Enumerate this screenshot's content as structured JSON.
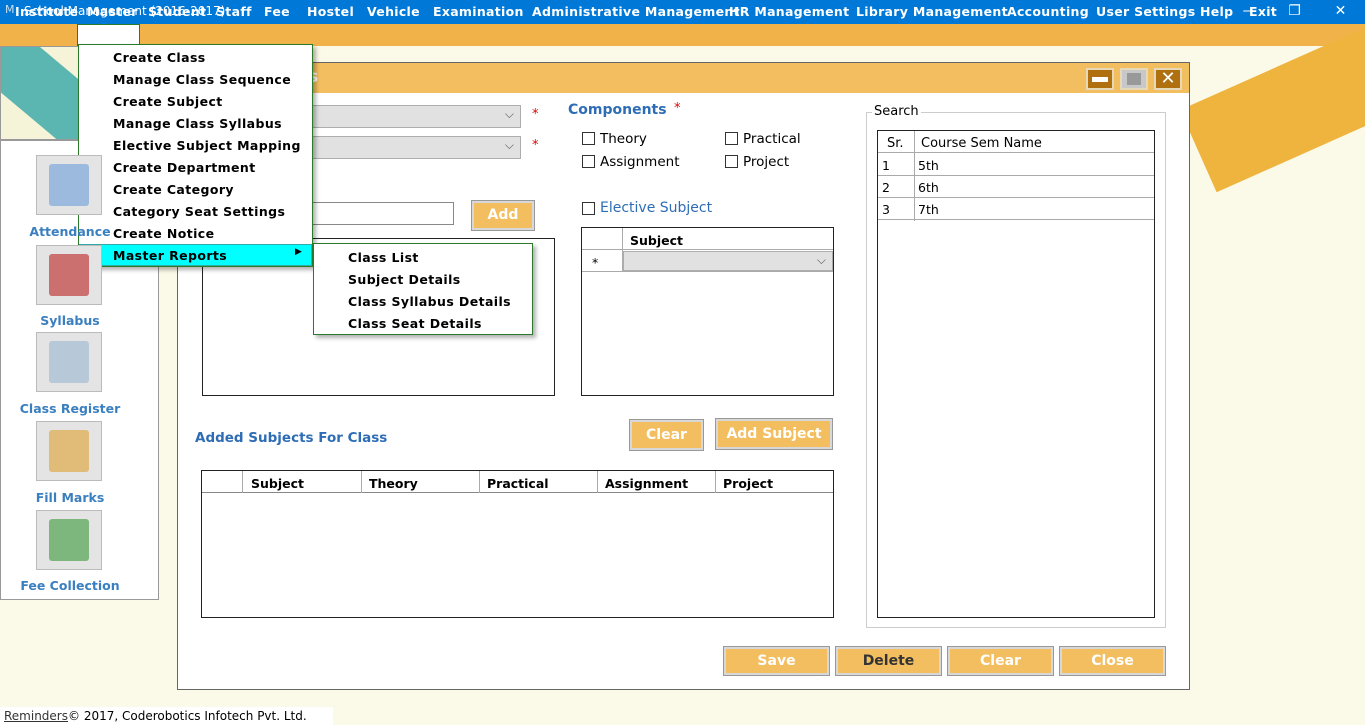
{
  "app": {
    "title": "School Management (2016-2017)",
    "controls": [
      "—",
      "❐",
      "✕"
    ]
  },
  "menubar": [
    "Institute",
    "Master",
    "Student",
    "Staff",
    "Fee",
    "Hostel",
    "Vehicle",
    "Examination",
    "Administrative Management",
    "HR Management",
    "Library Management",
    "Accounting",
    "User Settings",
    "Help",
    "Exit"
  ],
  "master_menu": [
    "Create Class",
    "Manage Class Sequence",
    "Create Subject",
    "Manage Class Syllabus",
    "Elective Subject Mapping",
    "Create Department",
    "Create Category",
    "Category Seat Settings",
    "Create Notice",
    "Master Reports"
  ],
  "submenu": [
    "Class  List",
    "Subject Details",
    "Class  Syllabus Details",
    "Class Seat Details"
  ],
  "sidebar": [
    "Attendance",
    "Syllabus",
    "Class Register",
    "Fill Marks",
    "Fee Collection"
  ],
  "window": {
    "title_fragment": "s"
  },
  "form": {
    "required": "*",
    "add": "Add",
    "components": "Components",
    "theory": "Theory",
    "practical": "Practical",
    "assignment": "Assignment",
    "project": "Project",
    "elective": "Elective Subject",
    "elective_grid_header": "Subject",
    "new_row": "*"
  },
  "added": {
    "label": "Added Subjects For Class",
    "clear": "Clear",
    "add_subject": "Add Subject",
    "columns": [
      "Subject",
      "Theory",
      "Practical",
      "Assignment",
      "Project"
    ]
  },
  "search": {
    "label": "Search",
    "columns": [
      "Sr.",
      "Course Sem Name"
    ],
    "rows": [
      [
        "1",
        "5th"
      ],
      [
        "2",
        "6th"
      ],
      [
        "3",
        "7th"
      ]
    ]
  },
  "actions": [
    "Save",
    "Delete",
    "Clear",
    "Close"
  ],
  "footer": {
    "reminders": "Reminders",
    "copyright": "© 2017, Coderobotics Infotech Pvt. Ltd."
  },
  "colors": {
    "titlebar": "#0078d7",
    "menubar": "#f2b24a",
    "highlight": "#00ffff",
    "accent_blue": "#2e6db5"
  }
}
